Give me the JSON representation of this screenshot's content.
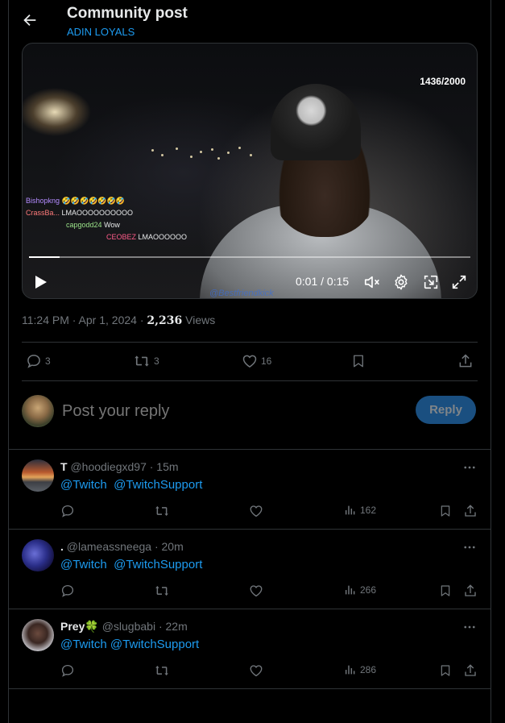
{
  "header": {
    "title": "Community post",
    "subtitle": "ADIN LOYALS"
  },
  "video": {
    "counter": "1436/2000",
    "chat": [
      {
        "user": "Bishopkng",
        "message": "🤣🤣🤣🤣🤣🤣🤣"
      },
      {
        "user": "CrassBa...",
        "message": "LMAOOOOOOOOOO"
      },
      {
        "user": "capgodd24",
        "message": "Wow"
      },
      {
        "user": "CEOBEZ",
        "message": "LMAOOOOOO"
      }
    ],
    "watermark": "@Bestfriendkick",
    "time": "0:01 / 0:15",
    "progress": 0.07
  },
  "meta": {
    "timestamp": "11:24 PM · Apr 1, 2024 · ",
    "views_count": "2,236",
    "views_label": " Views"
  },
  "post_actions": {
    "replies": "3",
    "reposts": "3",
    "likes": "16"
  },
  "reply_box": {
    "placeholder": "Post your reply",
    "button": "Reply"
  },
  "replies": [
    {
      "name": "T",
      "handle": "@hoodiegxd97",
      "time": "· 15m",
      "mentions": [
        "@Twitch",
        "@TwitchSupport"
      ],
      "views": "162"
    },
    {
      "name": ".",
      "handle": "@lameassneega",
      "time": "· 20m",
      "mentions": [
        "@Twitch",
        "@TwitchSupport"
      ],
      "views": "266"
    },
    {
      "name": "Prey🍀",
      "handle": "@slugbabi",
      "time": "· 22m",
      "mentions": [
        "@Twitch",
        "@TwitchSupport"
      ],
      "views": "286"
    }
  ],
  "colors": {
    "accent": "#1d9bf0",
    "muted": "#71767b",
    "border": "#2f3336",
    "reply_button": "#1a4f80"
  }
}
